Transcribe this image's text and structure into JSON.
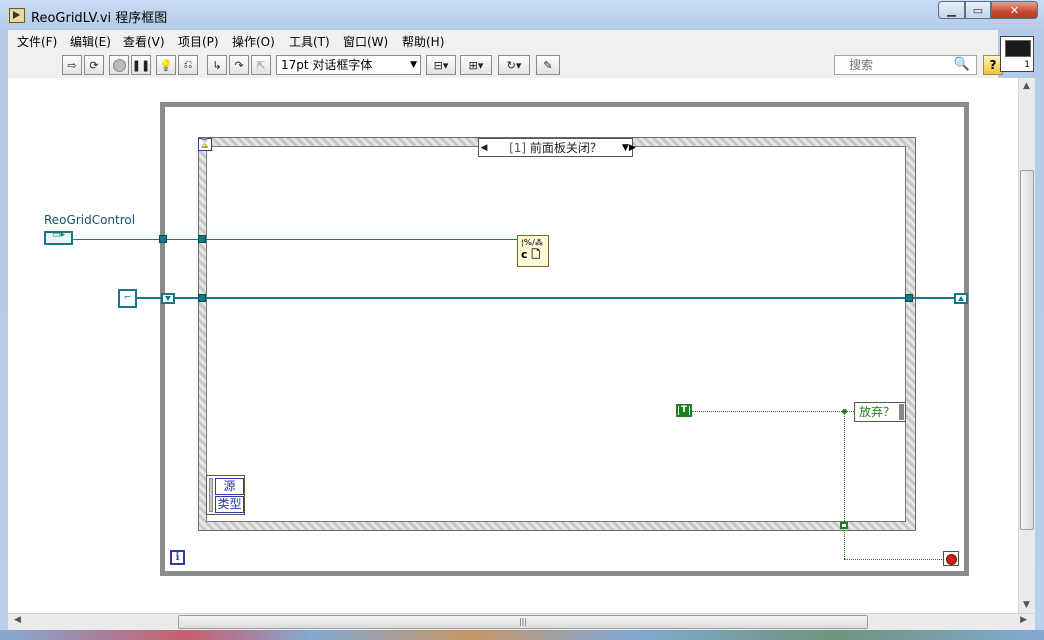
{
  "window": {
    "title": "ReoGridLV.vi 程序框图",
    "buttons": {
      "minimize": "▁",
      "maximize": "▭",
      "close": "✕"
    }
  },
  "menu": [
    "文件(F)",
    "编辑(E)",
    "查看(V)",
    "项目(P)",
    "操作(O)",
    "工具(T)",
    "窗口(W)",
    "帮助(H)"
  ],
  "toolbar": {
    "font_label": "17pt 对话框字体",
    "search_placeholder": "搜索",
    "help_label": "?"
  },
  "connector_pane": {
    "number": "1"
  },
  "diagram": {
    "control_label": "ReoGridControl",
    "event_selector": {
      "index": "[1]",
      "label": "前面板关闭？"
    },
    "node_top": "¦%/⁂",
    "node_bottom": "c 🗋",
    "bool_constant": "T",
    "discard_terminal": "放弃？",
    "event_data": [
      "源",
      "类型"
    ],
    "iteration_terminal": "i",
    "timeout_terminal": "⌛"
  },
  "scrollbar": {
    "grip": "|||"
  },
  "colors": {
    "refnum_wire": "#117a85",
    "boolean_wire": "#1b7f1b",
    "frame": "#8c8c8c"
  }
}
